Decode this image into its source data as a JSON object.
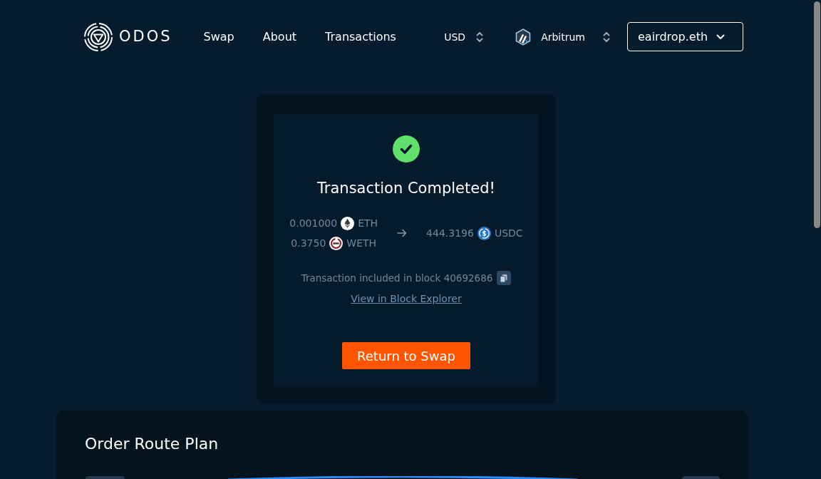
{
  "header": {
    "logo_text": "ODOS",
    "nav": [
      {
        "label": "Swap"
      },
      {
        "label": "About"
      },
      {
        "label": "Transactions"
      }
    ],
    "currency": "USD",
    "network": "Arbitrum",
    "wallet": "eairdrop.eth"
  },
  "transaction": {
    "title": "Transaction Completed!",
    "inputs": [
      {
        "amount": "0.001000",
        "kind": "diamond",
        "symbol": "ETH"
      },
      {
        "amount": "0.3750",
        "kind": "ring",
        "symbol": "WETH"
      }
    ],
    "outputs": [
      {
        "amount": "444.3196",
        "kind": "dollar",
        "symbol": "USDC"
      }
    ],
    "block_text": "Transaction included in block 40692686",
    "explorer_link": "View in Block Explorer",
    "button": "Return to Swap"
  },
  "route_plan": {
    "title": "Order Route Plan"
  }
}
